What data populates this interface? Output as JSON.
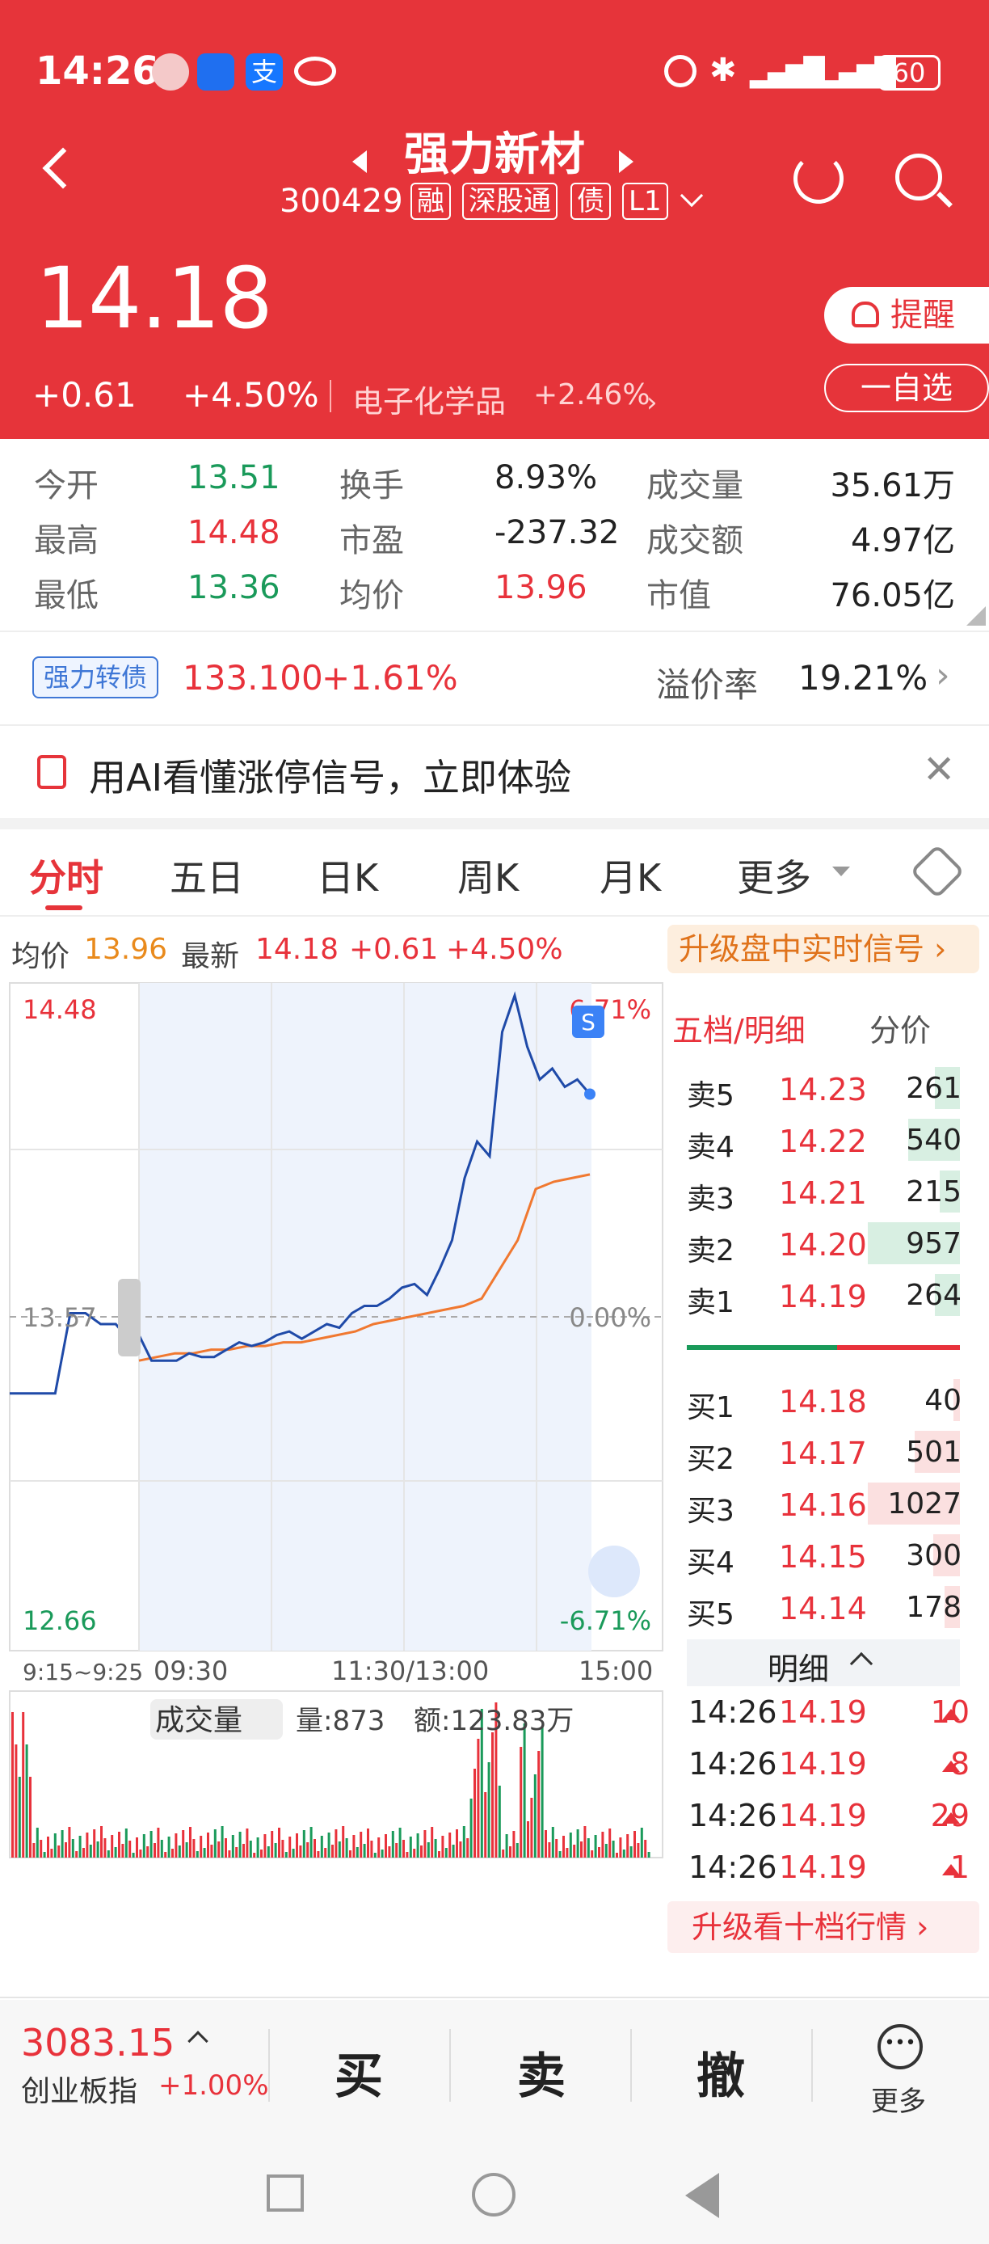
{
  "status": {
    "time": "14:26",
    "battery": "60"
  },
  "header": {
    "name": "强力新材",
    "code": "300429",
    "tags": [
      "融",
      "深股通",
      "债",
      "L1"
    ],
    "price": "14.18",
    "change": "+0.61",
    "change_pct": "+4.50%",
    "sector": "电子化学品",
    "sector_pct": "+2.46%",
    "remind_label": "提醒",
    "watchlist_label": "一自选"
  },
  "quote": {
    "rows": [
      {
        "l1": "今开",
        "v1": "13.51",
        "l2": "换手",
        "v2": "8.93%",
        "l3": "成交量",
        "v3": "35.61万"
      },
      {
        "l1": "最高",
        "v1": "14.48",
        "l2": "市盈",
        "v2": "-237.32",
        "l3": "成交额",
        "v3": "4.97亿"
      },
      {
        "l1": "最低",
        "v1": "13.36",
        "l2": "均价",
        "v2": "13.96",
        "l3": "市值",
        "v3": "76.05亿"
      }
    ]
  },
  "bond": {
    "tag": "强力转债",
    "price": "133.100",
    "pct": "+1.61%",
    "premium_label": "溢价率",
    "premium_value": "19.21%"
  },
  "banner": {
    "text": "用AI看懂涨停信号，立即体验"
  },
  "tabs": [
    "分时",
    "五日",
    "日K",
    "周K",
    "月K",
    "更多"
  ],
  "chart_info": {
    "avg_label": "均价",
    "avg_value": "13.96",
    "latest_label": "最新",
    "latest_value": "14.18",
    "latest_change": "+0.61",
    "latest_pct": "+4.50%",
    "upgrade_label": "升级盘中实时信号"
  },
  "chart_data": {
    "type": "line",
    "y_top": "14.48",
    "y_mid": "13.57",
    "y_bottom": "12.66",
    "pct_top": "6.71%",
    "pct_mid": "0.00%",
    "pct_bottom": "-6.71%",
    "ylim": [
      12.66,
      14.48
    ],
    "x_ticks": [
      "9:15~9:25",
      "09:30",
      "11:30/13:00",
      "15:00"
    ],
    "series": [
      {
        "values": [
          13.36,
          13.36,
          13.36,
          13.36,
          13.58,
          13.58,
          13.55,
          13.55,
          13.5,
          13.52,
          13.45,
          13.45,
          13.45,
          13.47,
          13.46,
          13.46,
          13.48,
          13.5,
          13.49,
          13.5,
          13.52,
          13.53,
          13.51,
          13.53,
          13.55,
          13.54,
          13.58,
          13.6,
          13.6,
          13.62,
          13.65,
          13.66,
          13.63,
          13.7,
          13.78,
          13.95,
          14.05,
          14.01,
          14.35,
          14.45,
          14.31,
          14.22,
          14.25,
          14.2,
          14.22,
          14.18
        ]
      },
      {
        "values": [
          13.45,
          13.46,
          13.47,
          13.47,
          13.48,
          13.48,
          13.49,
          13.49,
          13.5,
          13.5,
          13.51,
          13.52,
          13.53,
          13.55,
          13.56,
          13.57,
          13.58,
          13.59,
          13.6,
          13.62,
          13.7,
          13.78,
          13.92,
          13.94,
          13.95,
          13.96
        ]
      }
    ]
  },
  "volume": {
    "label": "成交量",
    "vol": "量:873",
    "amt": "额:123.83万"
  },
  "orderbook": {
    "header": "五档/明细",
    "header2": "分价",
    "asks": [
      {
        "label": "卖5",
        "price": "14.23",
        "vol": "261",
        "ratio": 0.27
      },
      {
        "label": "卖4",
        "price": "14.22",
        "vol": "540",
        "ratio": 0.56
      },
      {
        "label": "卖3",
        "price": "14.21",
        "vol": "215",
        "ratio": 0.22
      },
      {
        "label": "卖2",
        "price": "14.20",
        "vol": "957",
        "ratio": 1.0
      },
      {
        "label": "卖1",
        "price": "14.19",
        "vol": "264",
        "ratio": 0.27
      }
    ],
    "bids": [
      {
        "label": "买1",
        "price": "14.18",
        "vol": "40",
        "ratio": 0.04
      },
      {
        "label": "买2",
        "price": "14.17",
        "vol": "501",
        "ratio": 0.49
      },
      {
        "label": "买3",
        "price": "14.16",
        "vol": "1027",
        "ratio": 1.0
      },
      {
        "label": "买4",
        "price": "14.15",
        "vol": "300",
        "ratio": 0.29
      },
      {
        "label": "买5",
        "price": "14.14",
        "vol": "178",
        "ratio": 0.17
      }
    ],
    "detail_label": "明细",
    "ticks": [
      {
        "time": "14:26",
        "price": "14.19",
        "vol": "10"
      },
      {
        "time": "14:26",
        "price": "14.19",
        "vol": "8"
      },
      {
        "time": "14:26",
        "price": "14.19",
        "vol": "29"
      },
      {
        "time": "14:26",
        "price": "14.19",
        "vol": "1"
      }
    ],
    "upgrade_label": "升级看十档行情"
  },
  "bottom": {
    "index_value": "3083.15",
    "index_name": "创业板指",
    "index_pct": "+1.00%",
    "buy": "买",
    "sell": "卖",
    "cancel": "撤",
    "more": "更多"
  },
  "colors": {
    "header_red": "#e6343a",
    "up": "#e8323b",
    "down": "#1a9a5a",
    "line": "#1f4aa8",
    "avg": "#f07830"
  }
}
